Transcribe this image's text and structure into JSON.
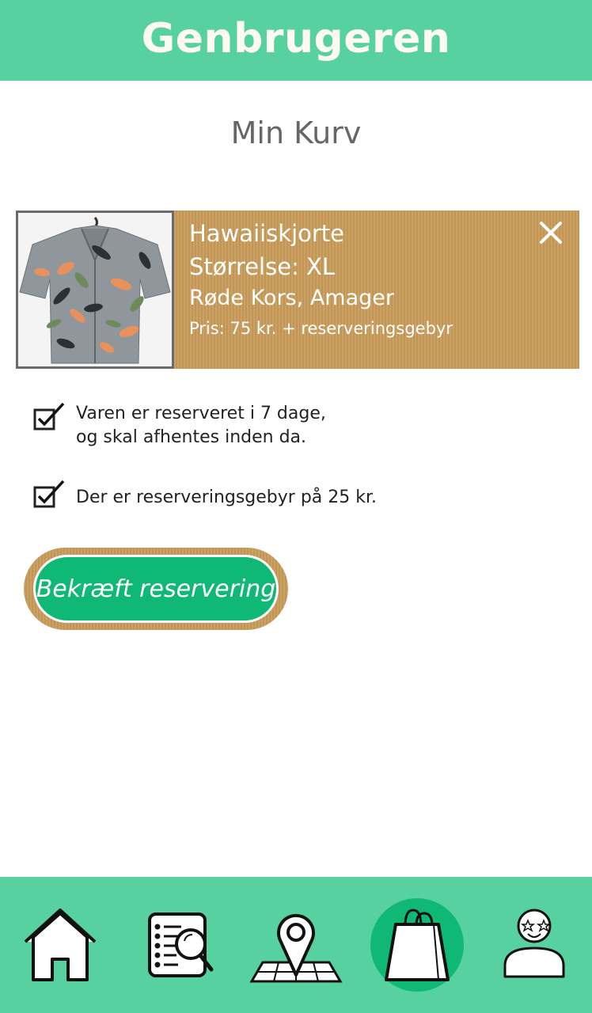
{
  "header": {
    "app_title": "Genbrugeren"
  },
  "page": {
    "title": "Min Kurv"
  },
  "cart_item": {
    "name": "Hawaiiskjorte",
    "size": "Størrelse: XL",
    "store": "Røde Kors, Amager",
    "price": "Pris: 75 kr. + reserveringsgebyr",
    "image_icon": "hawaiian-shirt-photo",
    "remove_icon": "close-icon"
  },
  "notices": [
    {
      "line1": "Varen er reserveret i 7 dage,",
      "line2": "og skal afhentes inden da.",
      "checked": true
    },
    {
      "line1": "Der er reserveringsgebyr på 25 kr.",
      "line2": "",
      "checked": true
    }
  ],
  "confirm": {
    "label": "Bekræft reservering"
  },
  "bottom_nav": {
    "items": [
      {
        "icon": "home-icon",
        "active": false
      },
      {
        "icon": "search-list-icon",
        "active": false
      },
      {
        "icon": "map-pin-icon",
        "active": false
      },
      {
        "icon": "shopping-bag-icon",
        "active": true
      },
      {
        "icon": "profile-icon",
        "active": false
      }
    ]
  },
  "colors": {
    "brand_green": "#57d1a0",
    "button_green": "#0fb875",
    "cardboard": "#c89b5a",
    "title_gray": "#666666"
  }
}
